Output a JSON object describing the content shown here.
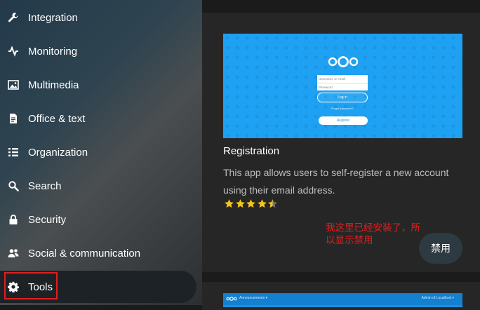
{
  "sidebar": {
    "items": [
      {
        "label": "Integration",
        "icon": "wrench-icon"
      },
      {
        "label": "Monitoring",
        "icon": "pulse-icon"
      },
      {
        "label": "Multimedia",
        "icon": "image-icon"
      },
      {
        "label": "Office & text",
        "icon": "document-icon"
      },
      {
        "label": "Organization",
        "icon": "list-icon"
      },
      {
        "label": "Search",
        "icon": "search-icon"
      },
      {
        "label": "Security",
        "icon": "lock-icon"
      },
      {
        "label": "Social & communication",
        "icon": "people-icon"
      },
      {
        "label": "Tools",
        "icon": "gear-icon",
        "active": true
      }
    ]
  },
  "app": {
    "name": "Registration",
    "description": "This app allows users to self-register a new account using their email address.",
    "rating": 4.5,
    "rating_max": 5,
    "annotation": "我这里已经安装了，所以显示禁用",
    "disable_label": "禁用",
    "screenshot": {
      "username_placeholder": "Username or email",
      "password_placeholder": "Password",
      "login_label": "Log in",
      "forgot_label": "Forgot password?",
      "register_label": "Register"
    }
  },
  "next_app": {
    "screenshot": {
      "menu_label": "Announcements ▾",
      "user_label": "Admin of Localhost ▾"
    }
  },
  "colors": {
    "accent": "#1ea1f2",
    "star": "#f5c518",
    "annotation": "#e02020",
    "highlight_box": "#e01e1e"
  }
}
